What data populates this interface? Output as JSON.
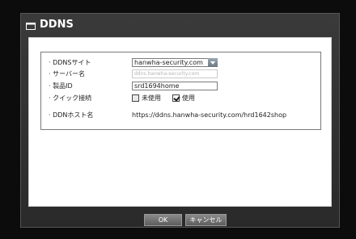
{
  "window": {
    "title": "DDNS"
  },
  "form": {
    "site_label": "· DDNSサイト",
    "site_value": "hanwha-security.com",
    "server_label": "· サーバー名",
    "server_placeholder": "ddns.hanwha-security.com",
    "product_id_label": "· 製品ID",
    "product_id_value": "srd1694home",
    "quick_connect_label": "· クイック接続",
    "quick_off_label": "未使用",
    "quick_on_label": "使用",
    "quick_off_checked": false,
    "quick_on_checked": true,
    "hostname_label": "· DDNホスト名",
    "hostname_value": "https://ddns.hanwha-security.com/hrd1642shop"
  },
  "buttons": {
    "ok": "OK",
    "cancel": "キャンセル"
  }
}
